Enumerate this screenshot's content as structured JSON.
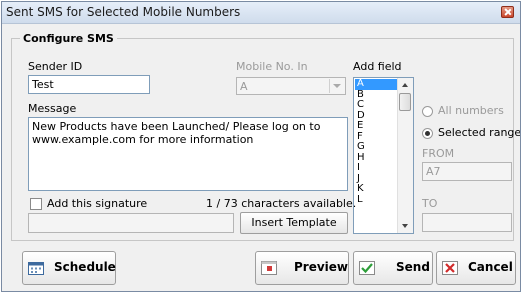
{
  "window": {
    "title": "Sent SMS for Selected Mobile Numbers"
  },
  "configure": {
    "legend": "Configure SMS",
    "sender_id_label": "Sender ID",
    "sender_id_value": "Test",
    "mobile_label": "Mobile No. In",
    "mobile_value": "A",
    "add_field_label": "Add field",
    "message_label": "Message",
    "message_value": "New Products have been Launched/ Please log on to\nwww.example.com for more information",
    "fields": [
      "A",
      "B",
      "C",
      "D",
      "E",
      "F",
      "G",
      "H",
      "I",
      "J",
      "K",
      "L"
    ],
    "selected_field": "A",
    "all_numbers_label": "All numbers",
    "selected_range_label": "Selected range",
    "from_label": "FROM",
    "from_value": "A7",
    "to_label": "TO",
    "to_value": "",
    "signature_label": "Add this signature",
    "char_count": "1 / 73 characters available.",
    "insert_template_label": "Insert Template"
  },
  "footer": {
    "schedule_label": "Schedule",
    "preview_label": "Preview",
    "send_label": "Send",
    "cancel_label": "Cancel"
  },
  "icons": {
    "close": "close-icon",
    "schedule": "calendar-icon",
    "preview": "preview-icon",
    "send": "checkmark-icon",
    "cancel": "x-mark-icon"
  }
}
